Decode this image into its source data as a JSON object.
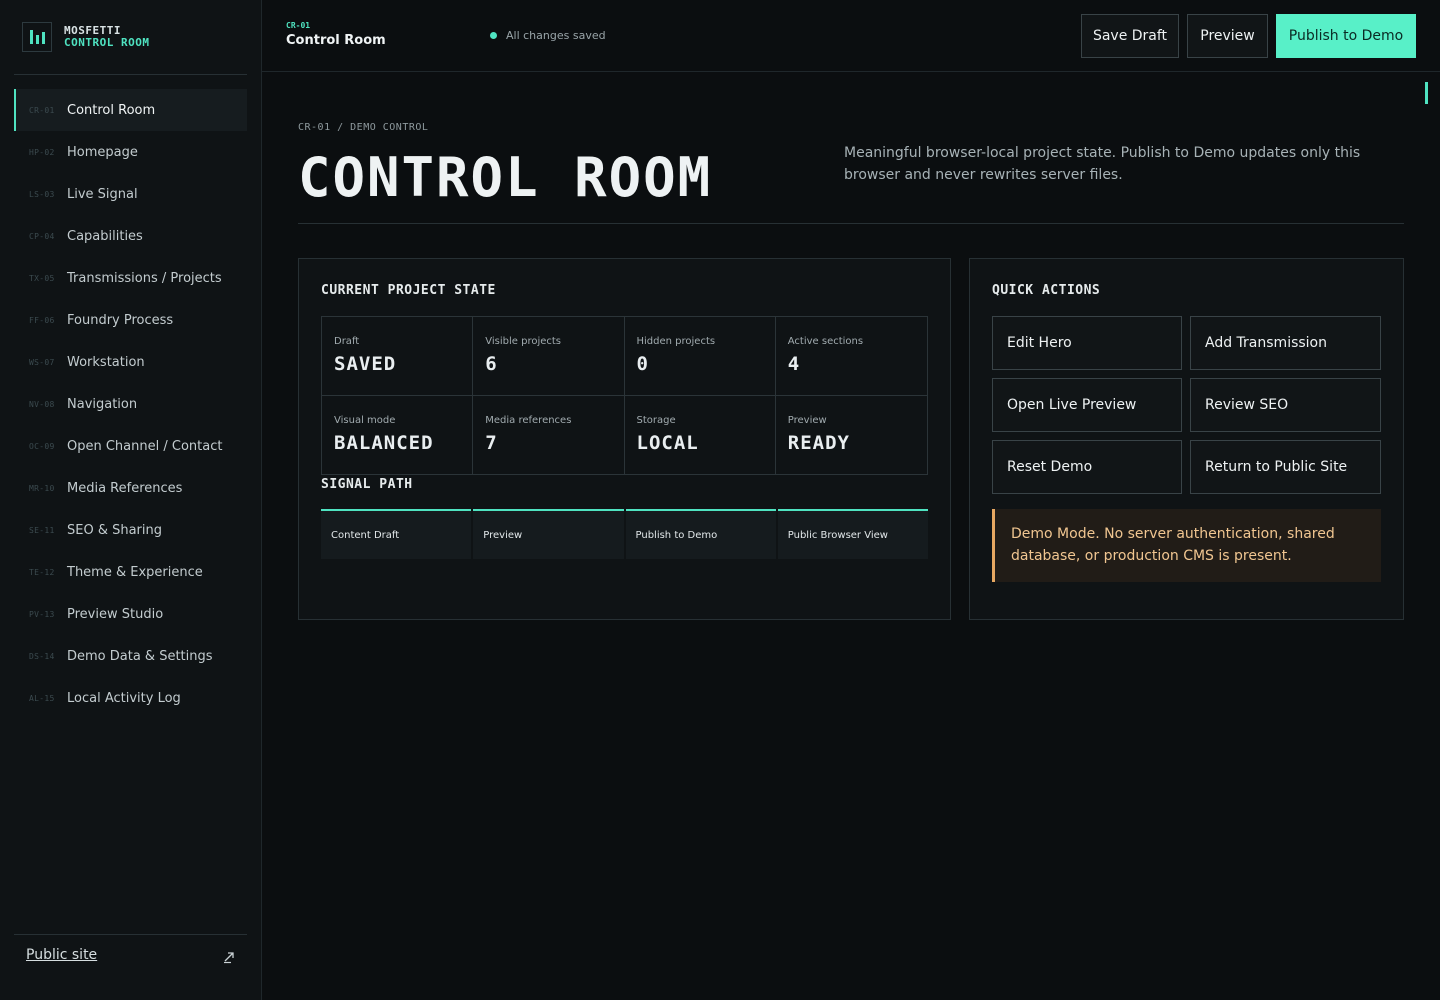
{
  "brand": {
    "line1": "MOSFETTI",
    "line2": "CONTROL ROOM",
    "accent": "#4fe3c1"
  },
  "sidebar": {
    "items": [
      {
        "code": "CR-01",
        "label": "Control Room",
        "active": true
      },
      {
        "code": "HP-02",
        "label": "Homepage"
      },
      {
        "code": "LS-03",
        "label": "Live Signal"
      },
      {
        "code": "CP-04",
        "label": "Capabilities"
      },
      {
        "code": "TX-05",
        "label": "Transmissions / Projects"
      },
      {
        "code": "FF-06",
        "label": "Foundry Process"
      },
      {
        "code": "WS-07",
        "label": "Workstation"
      },
      {
        "code": "NV-08",
        "label": "Navigation"
      },
      {
        "code": "OC-09",
        "label": "Open Channel / Contact"
      },
      {
        "code": "MR-10",
        "label": "Media References"
      },
      {
        "code": "SE-11",
        "label": "SEO & Sharing"
      },
      {
        "code": "TE-12",
        "label": "Theme & Experience"
      },
      {
        "code": "PV-13",
        "label": "Preview Studio"
      },
      {
        "code": "DS-14",
        "label": "Demo Data & Settings"
      },
      {
        "code": "AL-15",
        "label": "Local Activity Log"
      }
    ],
    "footer_link": "Public site",
    "footer_icon": "external-link-icon"
  },
  "topbar": {
    "code": "CR-01",
    "title": "Control Room",
    "status": "All changes saved",
    "save_label": "Save Draft",
    "preview_label": "Preview",
    "publish_label": "Publish to Demo"
  },
  "hero": {
    "breadcrumb": "CR-01 / DEMO CONTROL",
    "title": "CONTROL ROOM",
    "description": "Meaningful browser-local project state. Publish to Demo updates only this browser and never rewrites server files."
  },
  "state_panel": {
    "title": "CURRENT PROJECT STATE",
    "cells": [
      {
        "label": "Draft",
        "value": "SAVED"
      },
      {
        "label": "Visible projects",
        "value": "6"
      },
      {
        "label": "Hidden projects",
        "value": "0"
      },
      {
        "label": "Active sections",
        "value": "4"
      },
      {
        "label": "Visual mode",
        "value": "BALANCED"
      },
      {
        "label": "Media references",
        "value": "7"
      },
      {
        "label": "Storage",
        "value": "LOCAL"
      },
      {
        "label": "Preview",
        "value": "READY"
      }
    ],
    "signal_title": "SIGNAL PATH",
    "signal_steps": [
      "Content Draft",
      "Preview",
      "Publish to Demo",
      "Public Browser View"
    ]
  },
  "actions_panel": {
    "title": "QUICK ACTIONS",
    "buttons": [
      "Edit Hero",
      "Add Transmission",
      "Open Live Preview",
      "Review SEO",
      "Reset Demo",
      "Return to Public Site"
    ],
    "note": "Demo Mode. No server authentication, shared database, or production CMS is present."
  }
}
